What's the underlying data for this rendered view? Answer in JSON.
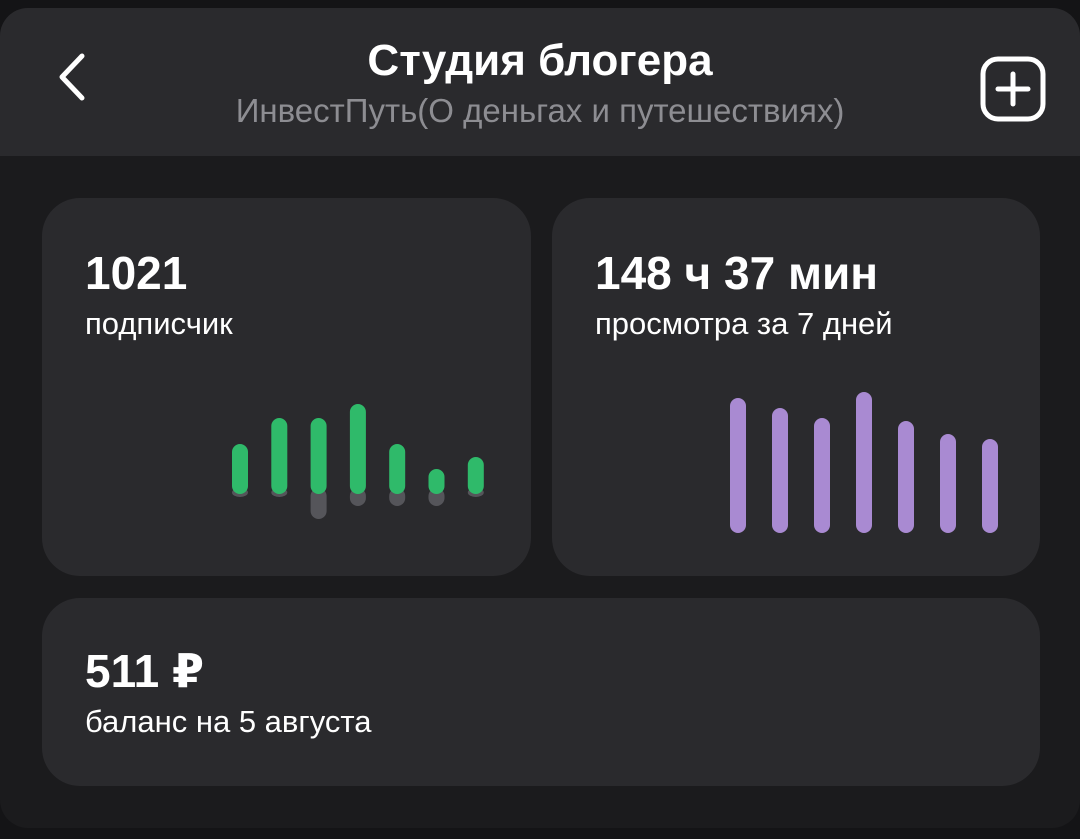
{
  "header": {
    "title": "Студия блогера",
    "subtitle": "ИнвестПуть(О деньгах и путешествиях)",
    "back_icon": "chevron-left-icon",
    "add_icon": "plus-square-icon"
  },
  "subscribers_card": {
    "value": "1021",
    "label": "подписчик",
    "chart": {
      "type": "bar",
      "gains": [
        50,
        76,
        76,
        90,
        50,
        25,
        37
      ],
      "losses": [
        3,
        3,
        25,
        12,
        12,
        12,
        3
      ],
      "gain_color": "#2fba6a",
      "loss_color": "#55555a"
    }
  },
  "views_card": {
    "value": "148 ч 37 мин",
    "label": "просмотра за 7 дней",
    "chart": {
      "type": "bar",
      "values": [
        135,
        125,
        115,
        141,
        112,
        99,
        94
      ],
      "color": "#a98ad2"
    }
  },
  "balance_card": {
    "value": "511 ₽",
    "label": "баланс на 5 августа"
  }
}
